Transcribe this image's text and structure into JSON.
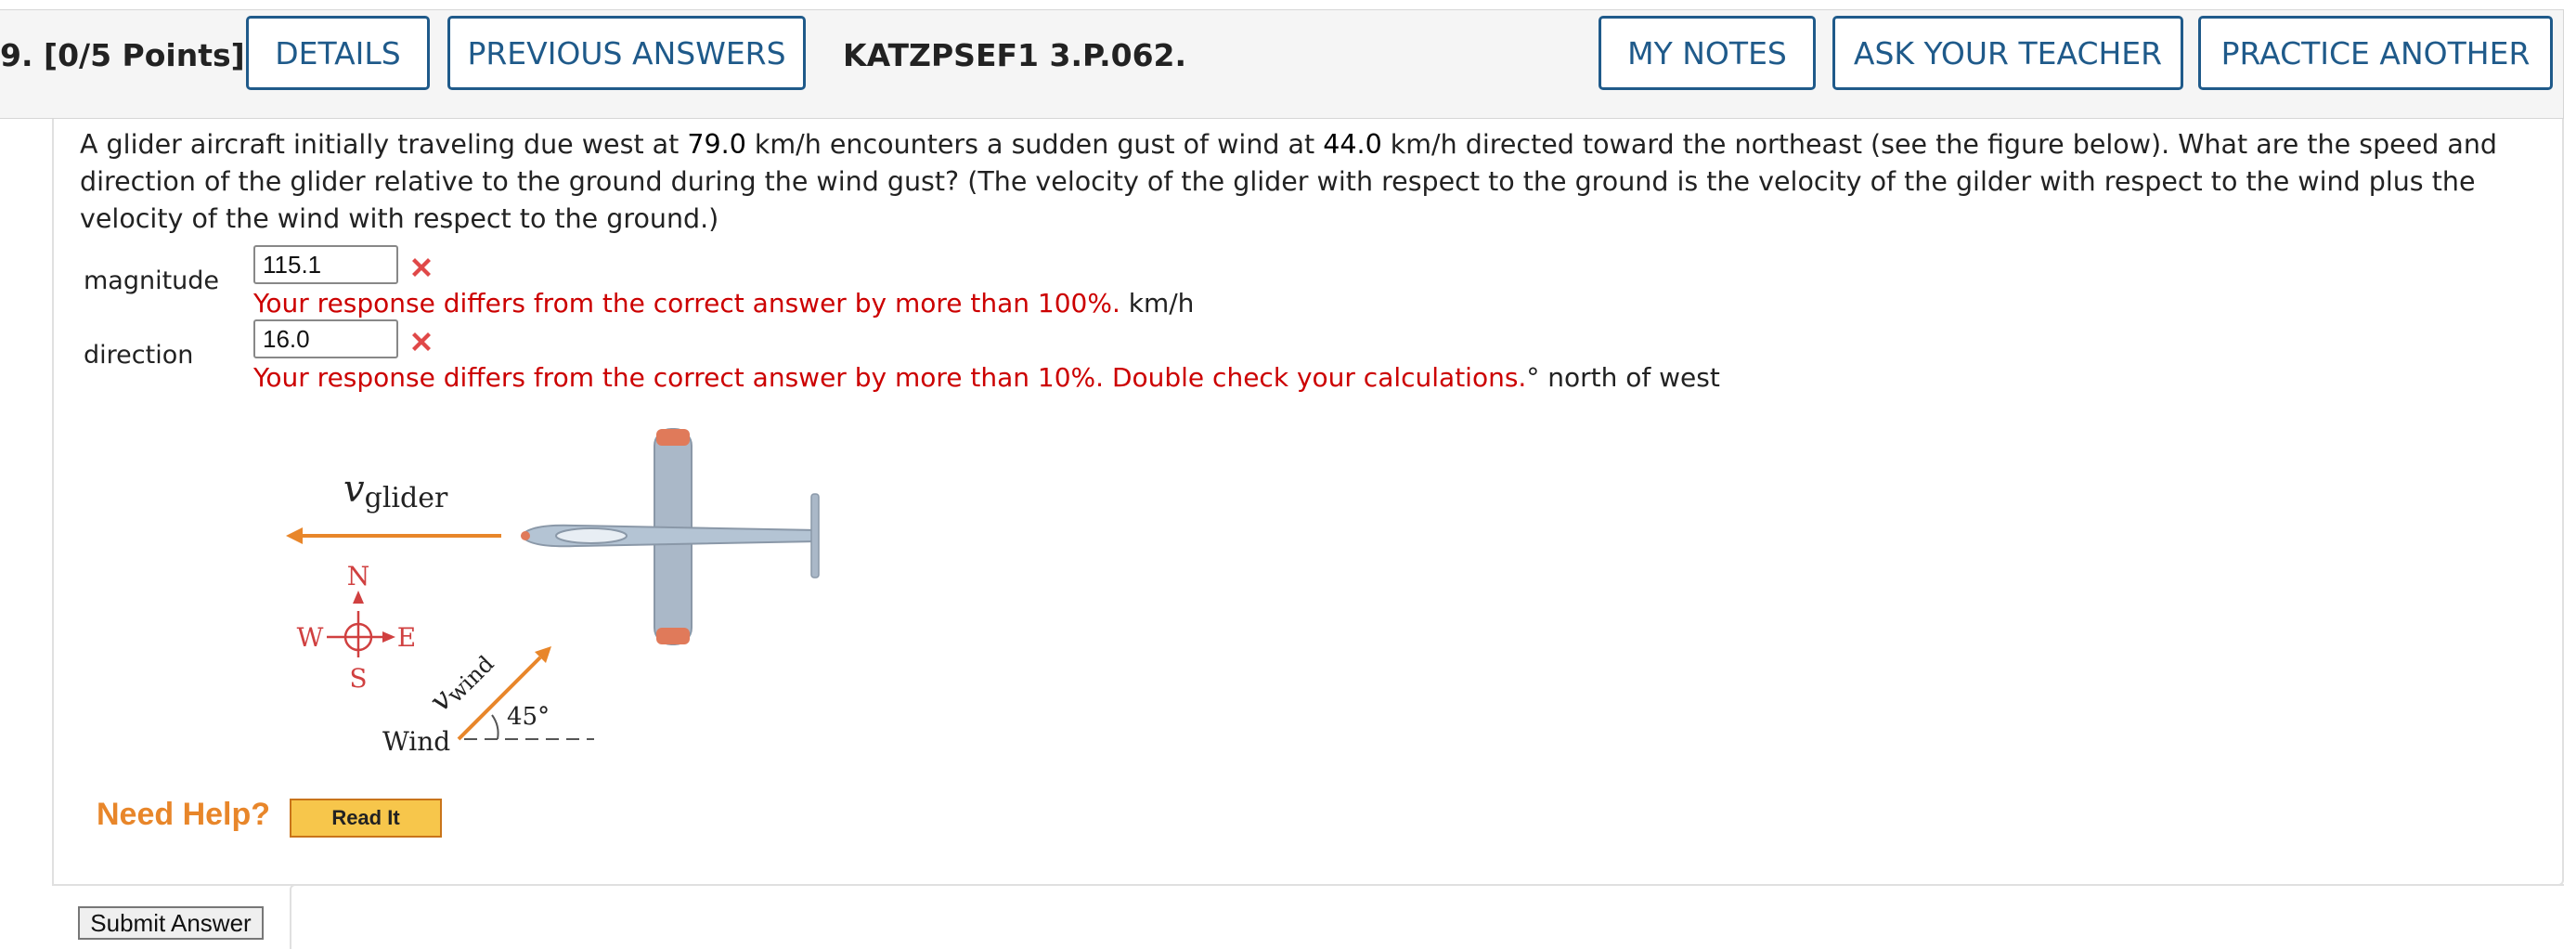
{
  "header": {
    "question_number": "9.",
    "points": "[0/5 Points]",
    "buttons": {
      "details": "DETAILS",
      "previous_answers": "PREVIOUS ANSWERS",
      "my_notes": "MY NOTES",
      "ask_teacher": "ASK YOUR TEACHER",
      "practice_another": "PRACTICE ANOTHER"
    },
    "question_code": "KATZPSEF1 3.P.062."
  },
  "question": {
    "text_1": "A glider aircraft initially traveling due west at ",
    "speed_glider": "79.0",
    "text_2": " km/h encounters a sudden gust of wind at ",
    "speed_wind": "44.0",
    "text_3": " km/h directed toward the northeast (see the figure below). What are the speed and direction of the glider relative to the ground during the wind gust? (The velocity of the glider with respect to the ground is the velocity of the gilder with respect to the wind plus the velocity of the wind with respect to the ground.)"
  },
  "answers": {
    "magnitude": {
      "label": "magnitude",
      "value": "115.1",
      "feedback": "Your response differs from the correct answer by more than 100%.",
      "unit": " km/h"
    },
    "direction": {
      "label": "direction",
      "value": "16.0",
      "feedback": "Your response differs from the correct answer by more than 10%. Double check your calculations.",
      "unit": "° north of west"
    }
  },
  "figure": {
    "v_glider_symbol": "v",
    "v_glider_sub": "glider",
    "compass": {
      "n": "N",
      "s": "S",
      "e": "E",
      "w": "W"
    },
    "v_wind_symbol": "v",
    "v_wind_sub": "wind",
    "angle": "45°",
    "wind_label": "Wind"
  },
  "help": {
    "need_help": "Need Help?",
    "read_it": "Read It"
  },
  "submit_label": "Submit Answer",
  "colors": {
    "button_blue": "#1f5a8a",
    "error_red": "#cc0000",
    "arrow_orange": "#e8862a",
    "compass_red": "#d04040"
  }
}
